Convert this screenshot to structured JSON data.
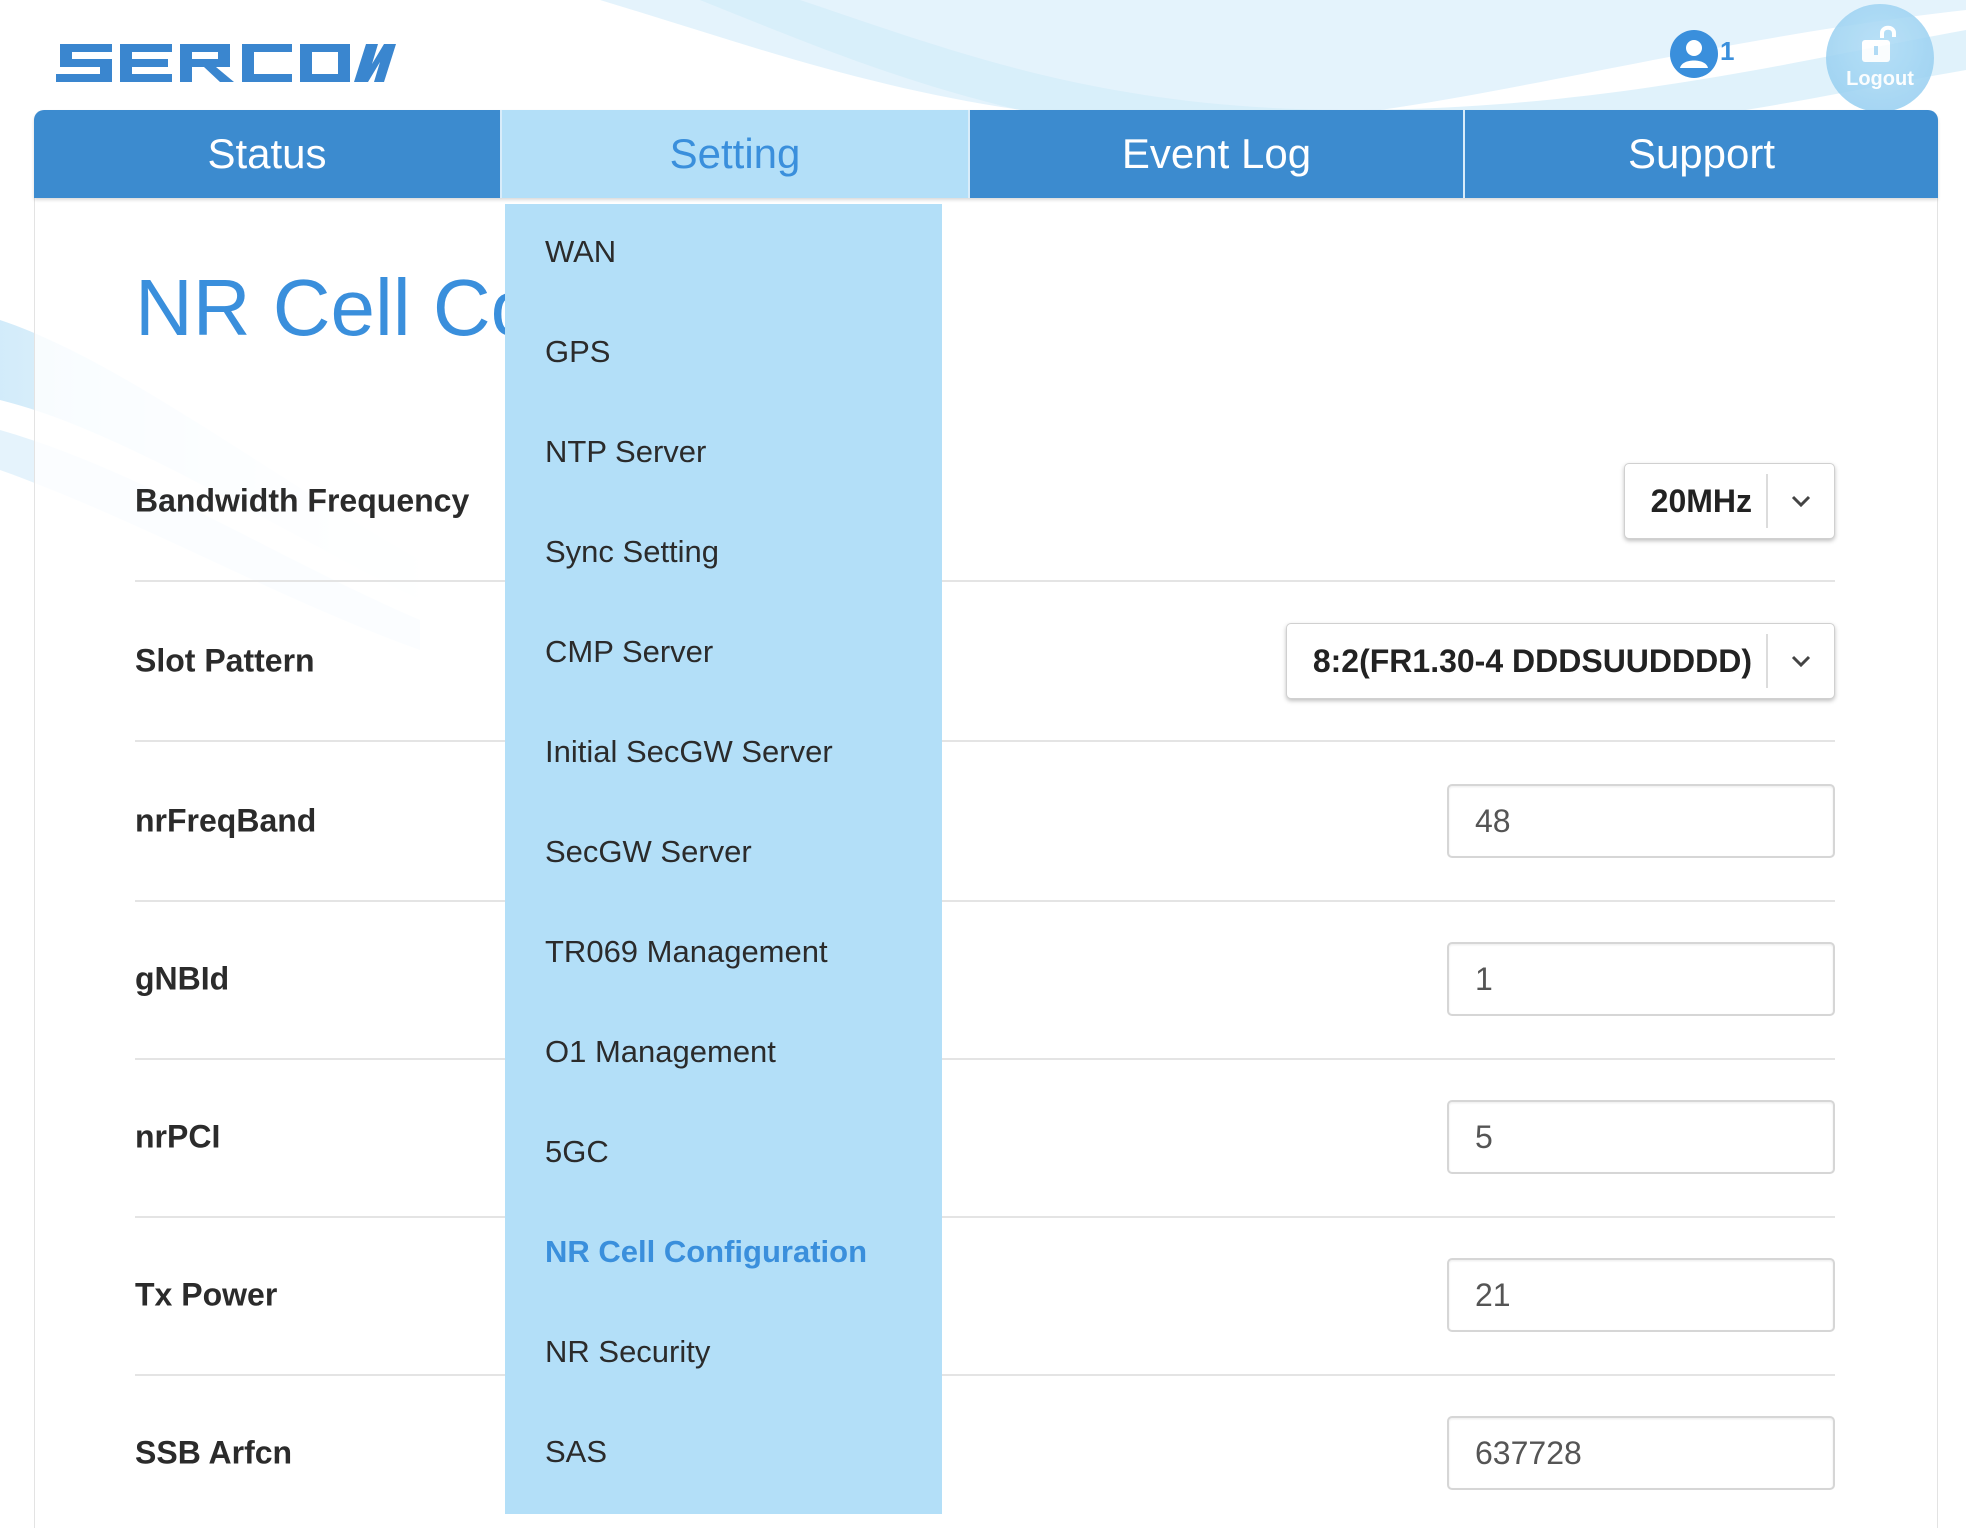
{
  "brand": {
    "logo_text": "SERCOM",
    "accent_color": "#3a8fdc",
    "nav_color": "#3c8bcf",
    "menu_color": "#b3dff8"
  },
  "header": {
    "user_count": "1",
    "logout_label": "Logout"
  },
  "nav": {
    "tabs": [
      {
        "label": "Status"
      },
      {
        "label": "Setting"
      },
      {
        "label": "Event Log"
      },
      {
        "label": "Support"
      }
    ],
    "active": "Setting"
  },
  "setting_menu": {
    "items": [
      {
        "label": "WAN"
      },
      {
        "label": "GPS"
      },
      {
        "label": "NTP Server"
      },
      {
        "label": "Sync Setting"
      },
      {
        "label": "CMP Server"
      },
      {
        "label": "Initial SecGW Server"
      },
      {
        "label": "SecGW Server"
      },
      {
        "label": "TR069 Management"
      },
      {
        "label": "O1 Management"
      },
      {
        "label": "5GC"
      },
      {
        "label": "NR Cell Configuration"
      },
      {
        "label": "NR Security"
      },
      {
        "label": "SAS"
      }
    ],
    "active": "NR Cell Configuration"
  },
  "page": {
    "title": "NR Cell Configuration"
  },
  "form": {
    "bandwidth_frequency": {
      "label": "Bandwidth Frequency",
      "value": "20MHz"
    },
    "slot_pattern": {
      "label": "Slot Pattern",
      "value": "8:2(FR1.30-4 DDDSUUDDDD)"
    },
    "nr_freq_band": {
      "label": "nrFreqBand",
      "value": "48"
    },
    "gnb_id": {
      "label": "gNBId",
      "value": "1"
    },
    "nr_pci": {
      "label": "nrPCI",
      "value": "5"
    },
    "tx_power": {
      "label": "Tx Power",
      "value": "21"
    },
    "ssb_arfcn": {
      "label": "SSB Arfcn",
      "value": "637728"
    }
  }
}
